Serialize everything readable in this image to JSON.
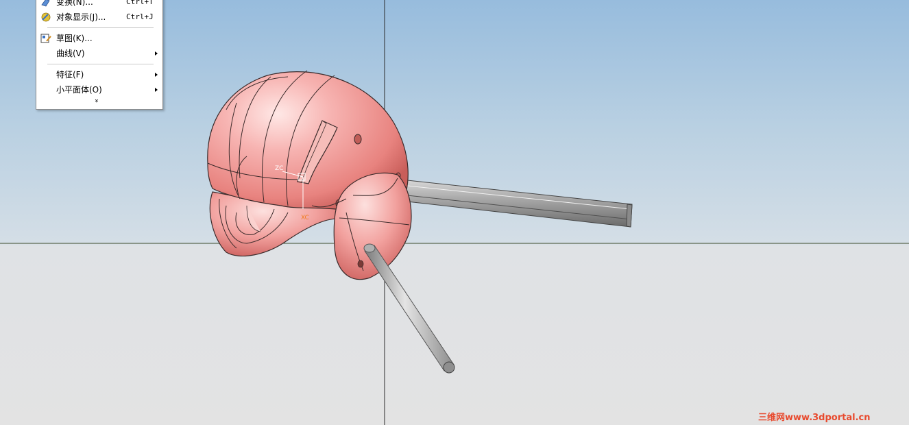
{
  "menu": {
    "items": [
      {
        "label": "变换(N)...",
        "shortcut": "Ctrl+T",
        "icon": "transform-icon"
      },
      {
        "label": "对象显示(J)...",
        "shortcut": "Ctrl+J",
        "icon": "object-display-icon"
      },
      {
        "label": "草图(K)...",
        "shortcut": "",
        "icon": "sketch-icon"
      },
      {
        "label": "曲线(V)",
        "shortcut": "",
        "icon": ""
      },
      {
        "label": "特征(F)",
        "shortcut": "",
        "icon": ""
      },
      {
        "label": "小平面体(O)",
        "shortcut": "",
        "icon": ""
      }
    ],
    "more_glyph": "»"
  },
  "wcs": {
    "zc": "ZC",
    "xc": "XC"
  },
  "watermark": "三维网www.3dportal.cn",
  "colors": {
    "part": "#f4a5a4",
    "edge": "#3a2a2a",
    "rod": "#b8b8b8",
    "accent": "#e84a2e"
  }
}
